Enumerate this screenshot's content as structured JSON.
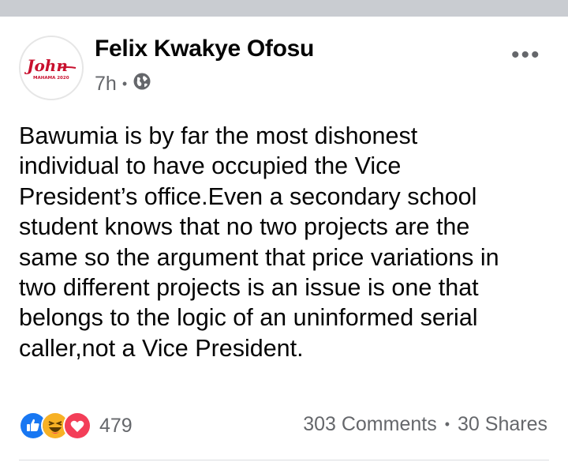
{
  "post": {
    "author": "Felix Kwakye Ofosu",
    "timestamp": "7h",
    "audience_icon": "globe-icon",
    "avatar_logo_text": "John",
    "avatar_logo_subtext": "MAHAMA 2020",
    "body": "Bawumia is by far the most dishonest\nindividual to have occupied the Vice\nPresident’s office.Even a secondary school\nstudent knows that no two projects are the\nsame so the argument that price variations in\ntwo different projects is an issue is one that\nbelongs to the logic of an uninformed serial\ncaller,not a Vice President.",
    "more_options_icon": "ellipsis-icon"
  },
  "engagement": {
    "reaction_icons": [
      "like-icon",
      "haha-icon",
      "love-icon"
    ],
    "reaction_count": "479",
    "comments": "303 Comments",
    "shares": "30 Shares"
  },
  "colors": {
    "like": "#1877f2",
    "love": "#f33e58",
    "haha": "#f7b125",
    "muted_text": "#65676b",
    "logo_red": "#c8102e"
  }
}
